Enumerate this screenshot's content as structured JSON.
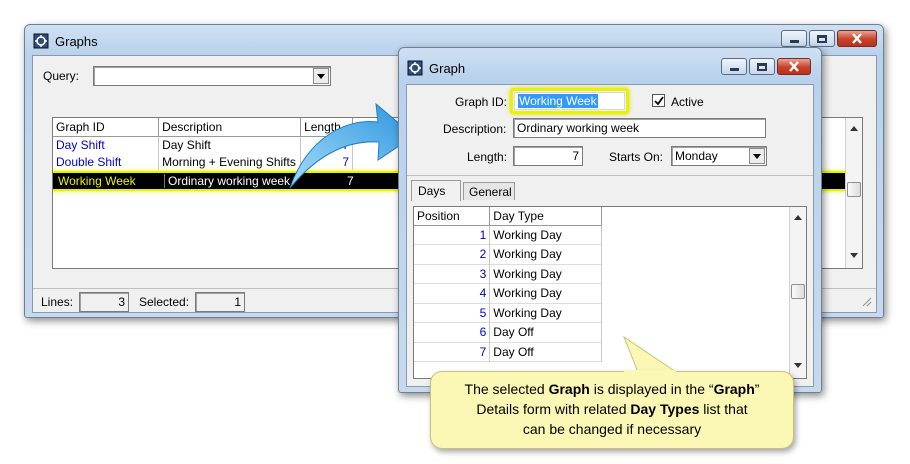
{
  "graphs_window": {
    "title": "Graphs",
    "query_label": "Query:",
    "query_value": "",
    "columns": [
      "Graph ID",
      "Description",
      "Length"
    ],
    "rows": [
      {
        "id": "Day Shift",
        "description": "Day Shift",
        "length": "7"
      },
      {
        "id": "Double Shift",
        "description": "Morning + Evening Shifts",
        "length": "7"
      },
      {
        "id": "Working Week",
        "description": "Ordinary working week",
        "length": "7"
      }
    ],
    "status": {
      "lines_label": "Lines:",
      "lines_value": "3",
      "selected_label": "Selected:",
      "selected_value": "1"
    }
  },
  "graph_window": {
    "title": "Graph",
    "graph_id_label": "Graph ID:",
    "graph_id_value": "Working Week",
    "active_label": "Active",
    "active_checked": true,
    "description_label": "Description:",
    "description_value": "Ordinary working week",
    "length_label": "Length:",
    "length_value": "7",
    "starts_on_label": "Starts On:",
    "starts_on_value": "Monday",
    "tabs": [
      "Days",
      "General"
    ],
    "day_columns": [
      "Position",
      "Day Type"
    ],
    "days": [
      {
        "position": "1",
        "type": "Working Day"
      },
      {
        "position": "2",
        "type": "Working Day"
      },
      {
        "position": "3",
        "type": "Working Day"
      },
      {
        "position": "4",
        "type": "Working Day"
      },
      {
        "position": "5",
        "type": "Working Day"
      },
      {
        "position": "6",
        "type": "Day Off"
      },
      {
        "position": "7",
        "type": "Day Off"
      }
    ]
  },
  "callout": {
    "t1": "The selected ",
    "b1": "Graph",
    "t2": " is displayed in the “",
    "b2": "Graph",
    "t3": "”",
    "t4": "Details form with related ",
    "b3": "Day Types",
    "t5": " list that",
    "t6": "can be changed if necessary"
  },
  "colors": {
    "link_blue": "#0000cc",
    "highlight_yellow": "#e8f200",
    "selection_bg": "#000000",
    "callout_bg": "#fbf7b4",
    "arrow_blue": "#3aa8e8"
  }
}
